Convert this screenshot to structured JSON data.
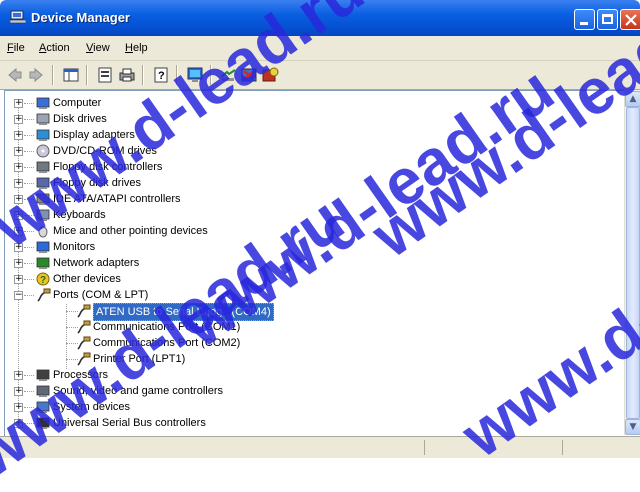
{
  "window": {
    "title": "Device Manager"
  },
  "menu": [
    {
      "label": "File",
      "u": "F",
      "rest": "ile"
    },
    {
      "label": "Action",
      "u": "A",
      "rest": "ction"
    },
    {
      "label": "View",
      "u": "V",
      "rest": "iew"
    },
    {
      "label": "Help",
      "u": "H",
      "rest": "elp"
    }
  ],
  "toolbar": [
    "back-icon",
    "forward-icon",
    "console-tree-icon",
    "properties-icon",
    "print-icon",
    "help-icon",
    "monitor-icon",
    "scan-hardware-icon",
    "uninstall-icon",
    "disable-icon"
  ],
  "tree": {
    "items": [
      {
        "label": "Computer",
        "icon": "computer-icon",
        "level": 1,
        "expander": "+"
      },
      {
        "label": "Disk drives",
        "icon": "disk-icon",
        "level": 1,
        "expander": "+"
      },
      {
        "label": "Display adapters",
        "icon": "display-icon",
        "level": 1,
        "expander": "+"
      },
      {
        "label": "DVD/CD-ROM drives",
        "icon": "cdrom-icon",
        "level": 1,
        "expander": "+"
      },
      {
        "label": "Floppy disk controllers",
        "icon": "controller-icon",
        "level": 1,
        "expander": "+"
      },
      {
        "label": "Floppy disk drives",
        "icon": "floppy-icon",
        "level": 1,
        "expander": "+"
      },
      {
        "label": "IDE ATA/ATAPI controllers",
        "icon": "ide-icon",
        "level": 1,
        "expander": "+"
      },
      {
        "label": "Keyboards",
        "icon": "keyboard-icon",
        "level": 1,
        "expander": "+"
      },
      {
        "label": "Mice and other pointing devices",
        "icon": "mouse-icon",
        "level": 1,
        "expander": "+"
      },
      {
        "label": "Monitors",
        "icon": "monitor-icon",
        "level": 1,
        "expander": "+"
      },
      {
        "label": "Network adapters",
        "icon": "network-icon",
        "level": 1,
        "expander": "+"
      },
      {
        "label": "Other devices",
        "icon": "unknown-device-icon",
        "level": 1,
        "expander": "+"
      },
      {
        "label": "Ports (COM & LPT)",
        "icon": "port-icon",
        "level": 1,
        "expander": "−"
      },
      {
        "label": "ATEN USB to Serial Bridge (COM4)",
        "icon": "port-icon",
        "level": 2,
        "selected": true
      },
      {
        "label": "Communications Port (COM1)",
        "icon": "port-icon",
        "level": 2
      },
      {
        "label": "Communications Port (COM2)",
        "icon": "port-icon",
        "level": 2
      },
      {
        "label": "Printer Port (LPT1)",
        "icon": "port-icon",
        "level": 2
      },
      {
        "label": "Processors",
        "icon": "processor-icon",
        "level": 1,
        "expander": "+"
      },
      {
        "label": "Sound, video and game controllers",
        "icon": "sound-icon",
        "level": 1,
        "expander": "+"
      },
      {
        "label": "System devices",
        "icon": "system-icon",
        "level": 1,
        "expander": "+"
      },
      {
        "label": "Universal Serial Bus controllers",
        "icon": "usb-icon",
        "level": 1,
        "expander": "+"
      }
    ]
  },
  "watermark": {
    "text": "www.d-lead.ru"
  }
}
